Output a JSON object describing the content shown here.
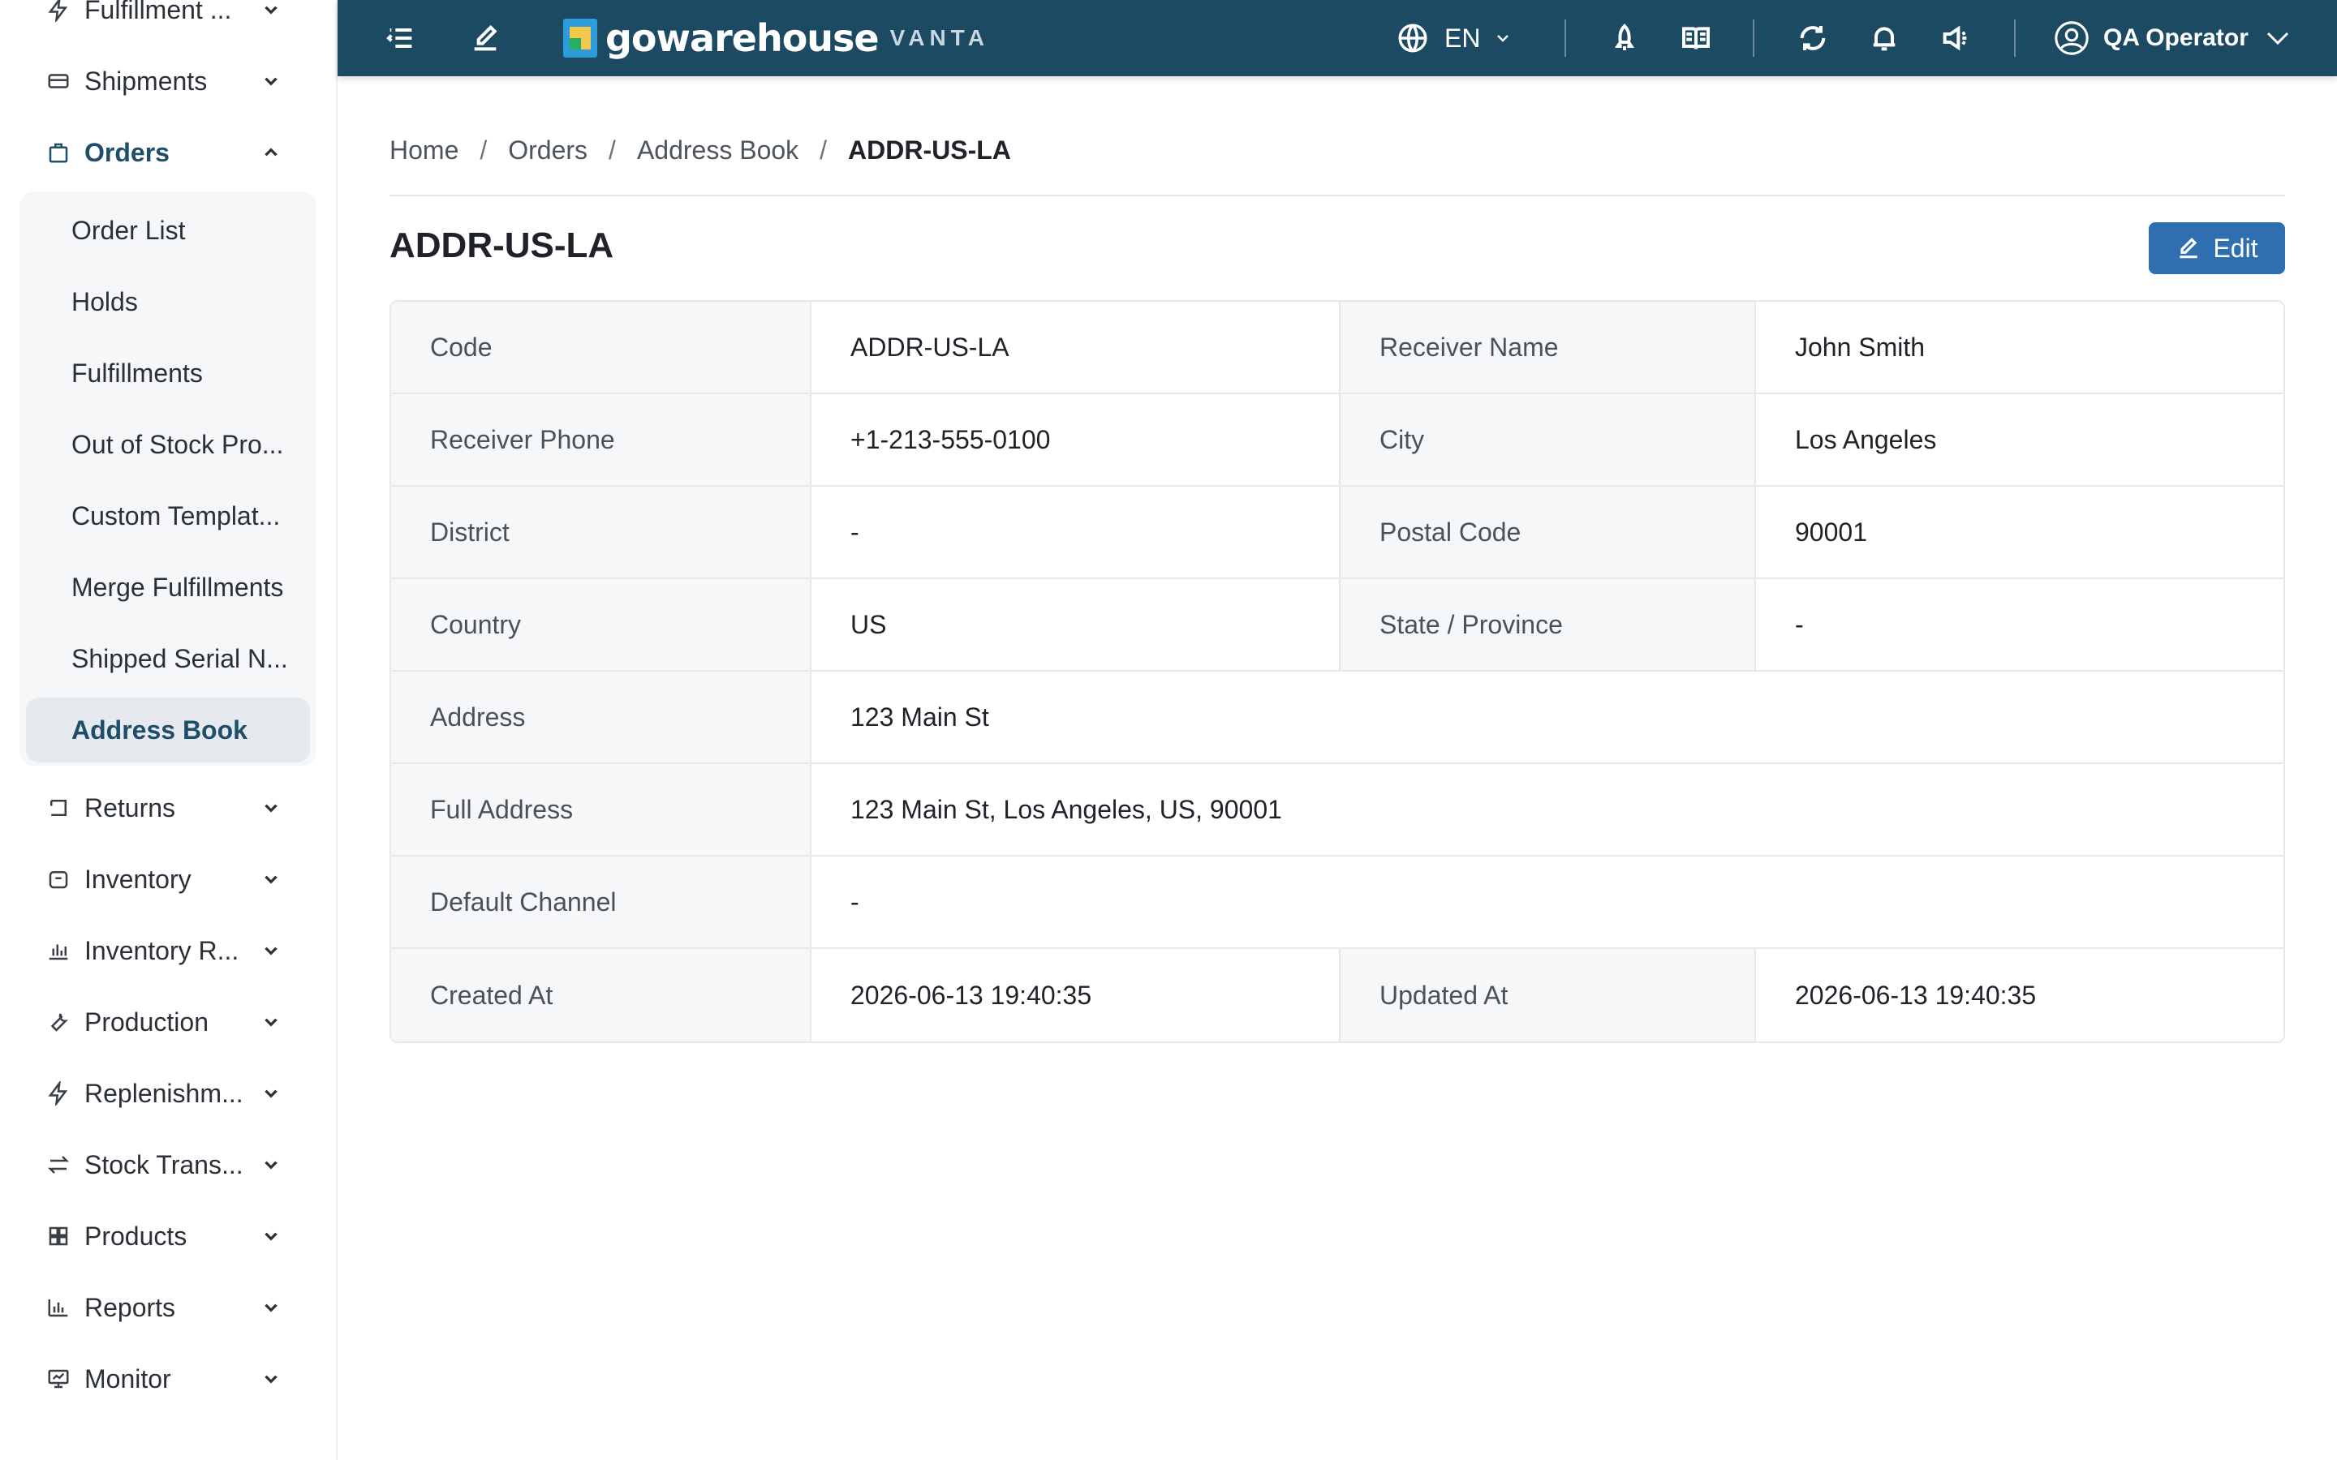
{
  "sidebar": {
    "items": [
      {
        "label": "Fulfillment ...",
        "icon": "bolt-icon"
      },
      {
        "label": "Shipments",
        "icon": "truck-icon"
      },
      {
        "label": "Orders",
        "icon": "bag-icon"
      },
      {
        "label": "Returns",
        "icon": "return-icon"
      },
      {
        "label": "Inventory",
        "icon": "box-icon"
      },
      {
        "label": "Inventory R...",
        "icon": "chart-icon"
      },
      {
        "label": "Production",
        "icon": "wrench-icon"
      },
      {
        "label": "Replenishm...",
        "icon": "bolt-icon"
      },
      {
        "label": "Stock Trans...",
        "icon": "transfer-icon"
      },
      {
        "label": "Products",
        "icon": "grid-icon"
      },
      {
        "label": "Reports",
        "icon": "bar-chart-icon"
      },
      {
        "label": "Monitor",
        "icon": "monitor-icon"
      }
    ],
    "orders_submenu": [
      "Order List",
      "Holds",
      "Fulfillments",
      "Out of Stock Pro...",
      "Custom Templat...",
      "Merge Fulfillments",
      "Shipped Serial N...",
      "Address Book"
    ]
  },
  "topbar": {
    "brand": "gowarehouse",
    "brand_sub": "VANTA",
    "language": "EN",
    "user": "QA Operator",
    "accent_color": "#1c4a63"
  },
  "breadcrumb": [
    "Home",
    "Orders",
    "Address Book",
    "ADDR-US-LA"
  ],
  "page": {
    "title": "ADDR-US-LA",
    "edit_label": "Edit"
  },
  "details": {
    "code_label": "Code",
    "code": "ADDR-US-LA",
    "receiver_name_label": "Receiver Name",
    "receiver_name": "John Smith",
    "receiver_phone_label": "Receiver Phone",
    "receiver_phone": "+1-213-555-0100",
    "city_label": "City",
    "city": "Los Angeles",
    "district_label": "District",
    "district": "-",
    "postal_code_label": "Postal Code",
    "postal_code": "90001",
    "country_label": "Country",
    "country": "US",
    "state_label": "State / Province",
    "state": "-",
    "address_label": "Address",
    "address": "123 Main St",
    "full_address_label": "Full Address",
    "full_address": "123 Main St, Los Angeles, US, 90001",
    "default_channel_label": "Default Channel",
    "default_channel": "-",
    "created_at_label": "Created At",
    "created_at": "2026-06-13 19:40:35",
    "updated_at_label": "Updated At",
    "updated_at": "2026-06-13 19:40:35"
  }
}
